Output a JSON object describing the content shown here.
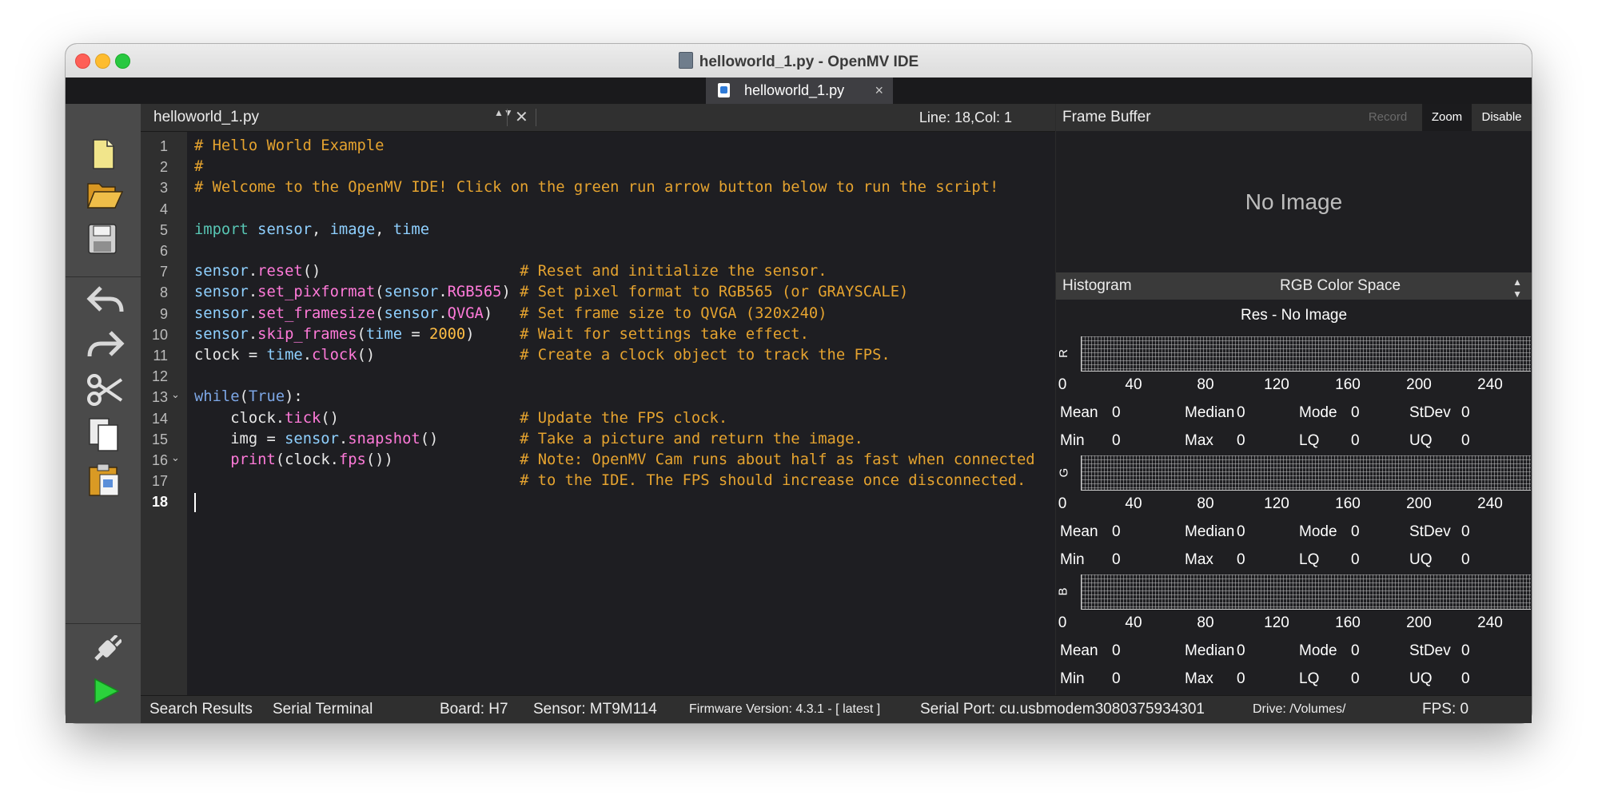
{
  "window": {
    "title": "helloworld_1.py - OpenMV IDE"
  },
  "tab": {
    "label": "helloworld_1.py",
    "close": "×"
  },
  "toolbar": {
    "items": [
      "new-file-icon",
      "open-folder-icon",
      "save-icon",
      "undo-icon",
      "redo-icon",
      "cut-icon",
      "copy-icon",
      "paste-icon",
      "connect-icon",
      "run-icon"
    ]
  },
  "editor": {
    "file_name": "helloworld_1.py",
    "updown": "▲▼",
    "close": "✕",
    "cursor_position": "Line: 18,Col: 1",
    "line_numbers": [
      "1",
      "2",
      "3",
      "4",
      "5",
      "6",
      "7",
      "8",
      "9",
      "10",
      "11",
      "12",
      "13",
      "14",
      "15",
      "16",
      "17",
      "18"
    ],
    "active_line": "18",
    "lines": [
      "# Hello World Example",
      "#",
      "# Welcome to the OpenMV IDE! Click on the green run arrow button below to run the script!",
      "",
      "import sensor, image, time",
      "",
      "sensor.reset()                      # Reset and initialize the sensor.",
      "sensor.set_pixformat(sensor.RGB565) # Set pixel format to RGB565 (or GRAYSCALE)",
      "sensor.set_framesize(sensor.QVGA)   # Set frame size to QVGA (320x240)",
      "sensor.skip_frames(time = 2000)     # Wait for settings take effect.",
      "clock = time.clock()                # Create a clock object to track the FPS.",
      "",
      "while(True):",
      "    clock.tick()                    # Update the FPS clock.",
      "    img = sensor.snapshot()         # Take a picture and return the image.",
      "    print(clock.fps())              # Note: OpenMV Cam runs about half as fast when connected",
      "                                    # to the IDE. The FPS should increase once disconnected.",
      ""
    ]
  },
  "frame_buffer": {
    "title": "Frame Buffer",
    "record": "Record",
    "zoom": "Zoom",
    "disable": "Disable",
    "no_image": "No Image"
  },
  "histogram": {
    "title": "Histogram",
    "color_space": "RGB Color Space",
    "resolution": "Res - No Image",
    "ticks": [
      "0",
      "40",
      "80",
      "120",
      "160",
      "200",
      "240"
    ],
    "channels": [
      {
        "name": "R",
        "stats": {
          "mean": "0",
          "median": "0",
          "mode": "0",
          "stdev": "0",
          "min": "0",
          "max": "0",
          "lq": "0",
          "uq": "0"
        }
      },
      {
        "name": "G",
        "stats": {
          "mean": "0",
          "median": "0",
          "mode": "0",
          "stdev": "0",
          "min": "0",
          "max": "0",
          "lq": "0",
          "uq": "0"
        }
      },
      {
        "name": "B",
        "stats": {
          "mean": "0",
          "median": "0",
          "mode": "0",
          "stdev": "0",
          "min": "0",
          "max": "0",
          "lq": "0",
          "uq": "0"
        }
      }
    ],
    "stat_labels": {
      "mean": "Mean",
      "median": "Median",
      "mode": "Mode",
      "stdev": "StDev",
      "min": "Min",
      "max": "Max",
      "lq": "LQ",
      "uq": "UQ"
    }
  },
  "statusbar": {
    "search_results": "Search Results",
    "serial_terminal": "Serial Terminal",
    "board": "Board: H7",
    "sensor": "Sensor: MT9M114",
    "firmware": "Firmware Version: 4.3.1 - [ latest ]",
    "serial_port": "Serial Port: cu.usbmodem3080375934301",
    "drive": "Drive: /Volumes/",
    "fps": "FPS: 0"
  }
}
